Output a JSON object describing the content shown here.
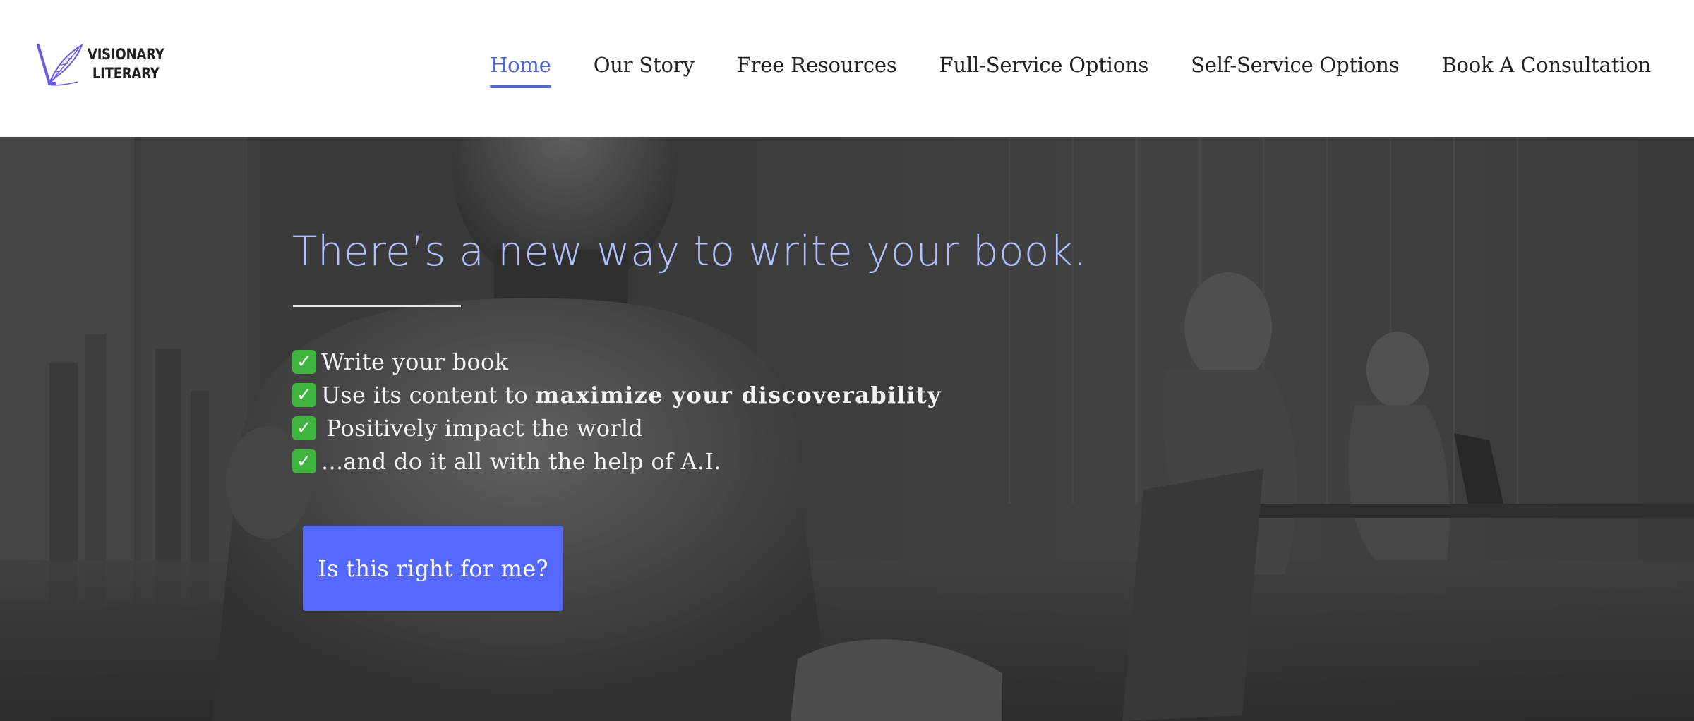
{
  "brand": {
    "line1": "VISIONARY",
    "line2": "LITERARY",
    "accent_color": "#6b5ce7"
  },
  "nav": {
    "items": [
      {
        "label": "Home",
        "active": true
      },
      {
        "label": "Our Story",
        "active": false
      },
      {
        "label": "Free Resources",
        "active": false
      },
      {
        "label": "Full-Service Options",
        "active": false
      },
      {
        "label": "Self-Service Options",
        "active": false
      },
      {
        "label": "Book A Consultation",
        "active": false
      }
    ],
    "active_color": "#4e66d8"
  },
  "hero": {
    "title": "There’s a new way to write your book.",
    "title_color": "#b3c0ff",
    "check_icon": "white-check-mark-emoji",
    "benefits": [
      {
        "text": "Write your book"
      },
      {
        "prefix": "Use its content to ",
        "bold": "maximize your discoverability"
      },
      {
        "text": "Positively impact the world"
      },
      {
        "text": "...and do it all with the help of A.I."
      }
    ],
    "background_image": "robots-working-on-laptops-in-office",
    "cta_label": "Is this right for me?",
    "cta_color": "#5468ff"
  }
}
